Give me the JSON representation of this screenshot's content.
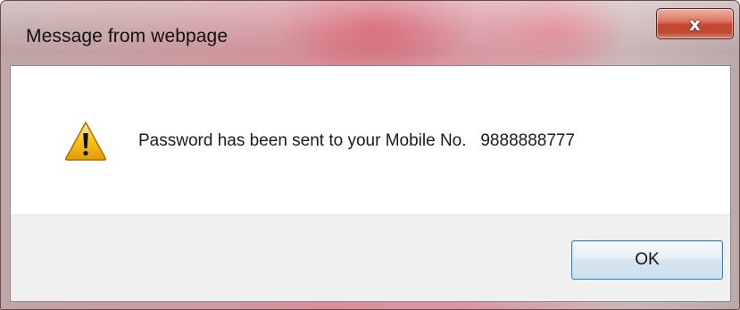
{
  "dialog": {
    "title": "Message from webpage",
    "close_icon": "close-icon",
    "close_label": "x",
    "message": "Password has been sent to your Mobile No.   9888888777",
    "icon": "warning-icon",
    "ok_label": "OK"
  },
  "colors": {
    "accent": "#c6462f",
    "ok_border": "#3c7fb1",
    "warning_yellow": "#f6c21a"
  }
}
